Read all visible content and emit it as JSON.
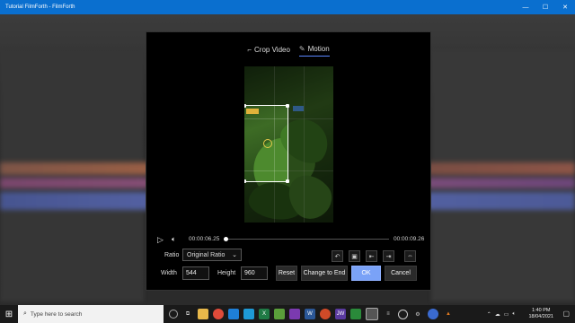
{
  "window": {
    "title": "Tutorial FilmForth - FilmForth",
    "controls": [
      "minimize-icon",
      "maximize-icon",
      "close-icon"
    ]
  },
  "dialog": {
    "tabs": [
      {
        "label": "Crop Video",
        "icon": "crop-icon",
        "active": false
      },
      {
        "label": "Motion",
        "icon": "edit-icon",
        "active": true
      }
    ],
    "playback": {
      "current_time": "00:00:06.25",
      "end_time": "00:00:09.26",
      "progress": 0.0
    },
    "ratio": {
      "label": "Ratio",
      "selected": "Original Ratio"
    },
    "tools": [
      "rotate-left-icon",
      "fit-icon",
      "align-left-icon",
      "align-right-icon",
      "flip-icon"
    ],
    "width": {
      "label": "Width",
      "value": "544"
    },
    "height": {
      "label": "Height",
      "value": "960"
    },
    "buttons": {
      "reset": "Reset",
      "change_to_end": "Change to End",
      "ok": "OK",
      "cancel": "Cancel"
    },
    "colors": {
      "accent": "#7aa2f7",
      "handle_tag": "#e0b23a"
    }
  },
  "taskbar": {
    "search_placeholder": "Type here to search",
    "time": "1:40 PM",
    "date": "18/04/2021"
  }
}
